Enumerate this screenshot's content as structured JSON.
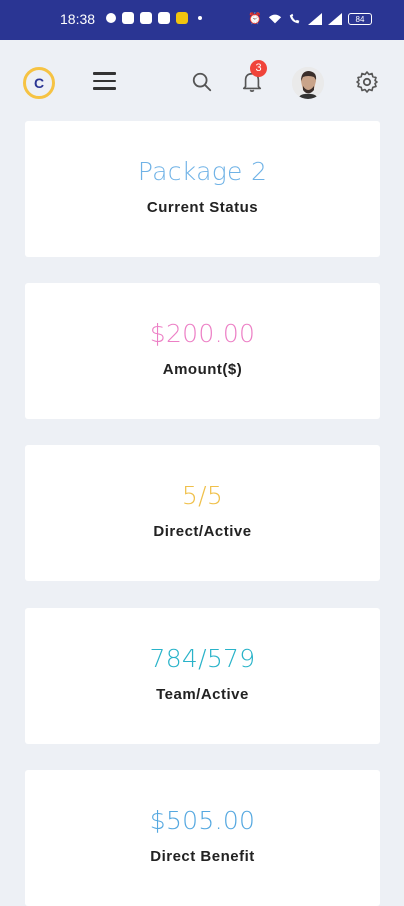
{
  "status_bar": {
    "time": "18:38",
    "battery": "84"
  },
  "header": {
    "logo_letter": "C",
    "notification_count": "3"
  },
  "cards": [
    {
      "value": "Package 2",
      "label": "Current Status",
      "color": "#6fb2e6"
    },
    {
      "value": "$200.00",
      "label": "Amount($)",
      "color": "#ec7fc5"
    },
    {
      "value": "5/5",
      "label": "Direct/Active",
      "color": "#f0c04a"
    },
    {
      "value": "784/579",
      "label": "Team/Active",
      "color": "#29b3c9"
    },
    {
      "value": "$505.00",
      "label": "Direct Benefit",
      "color": "#55a8e0"
    }
  ]
}
